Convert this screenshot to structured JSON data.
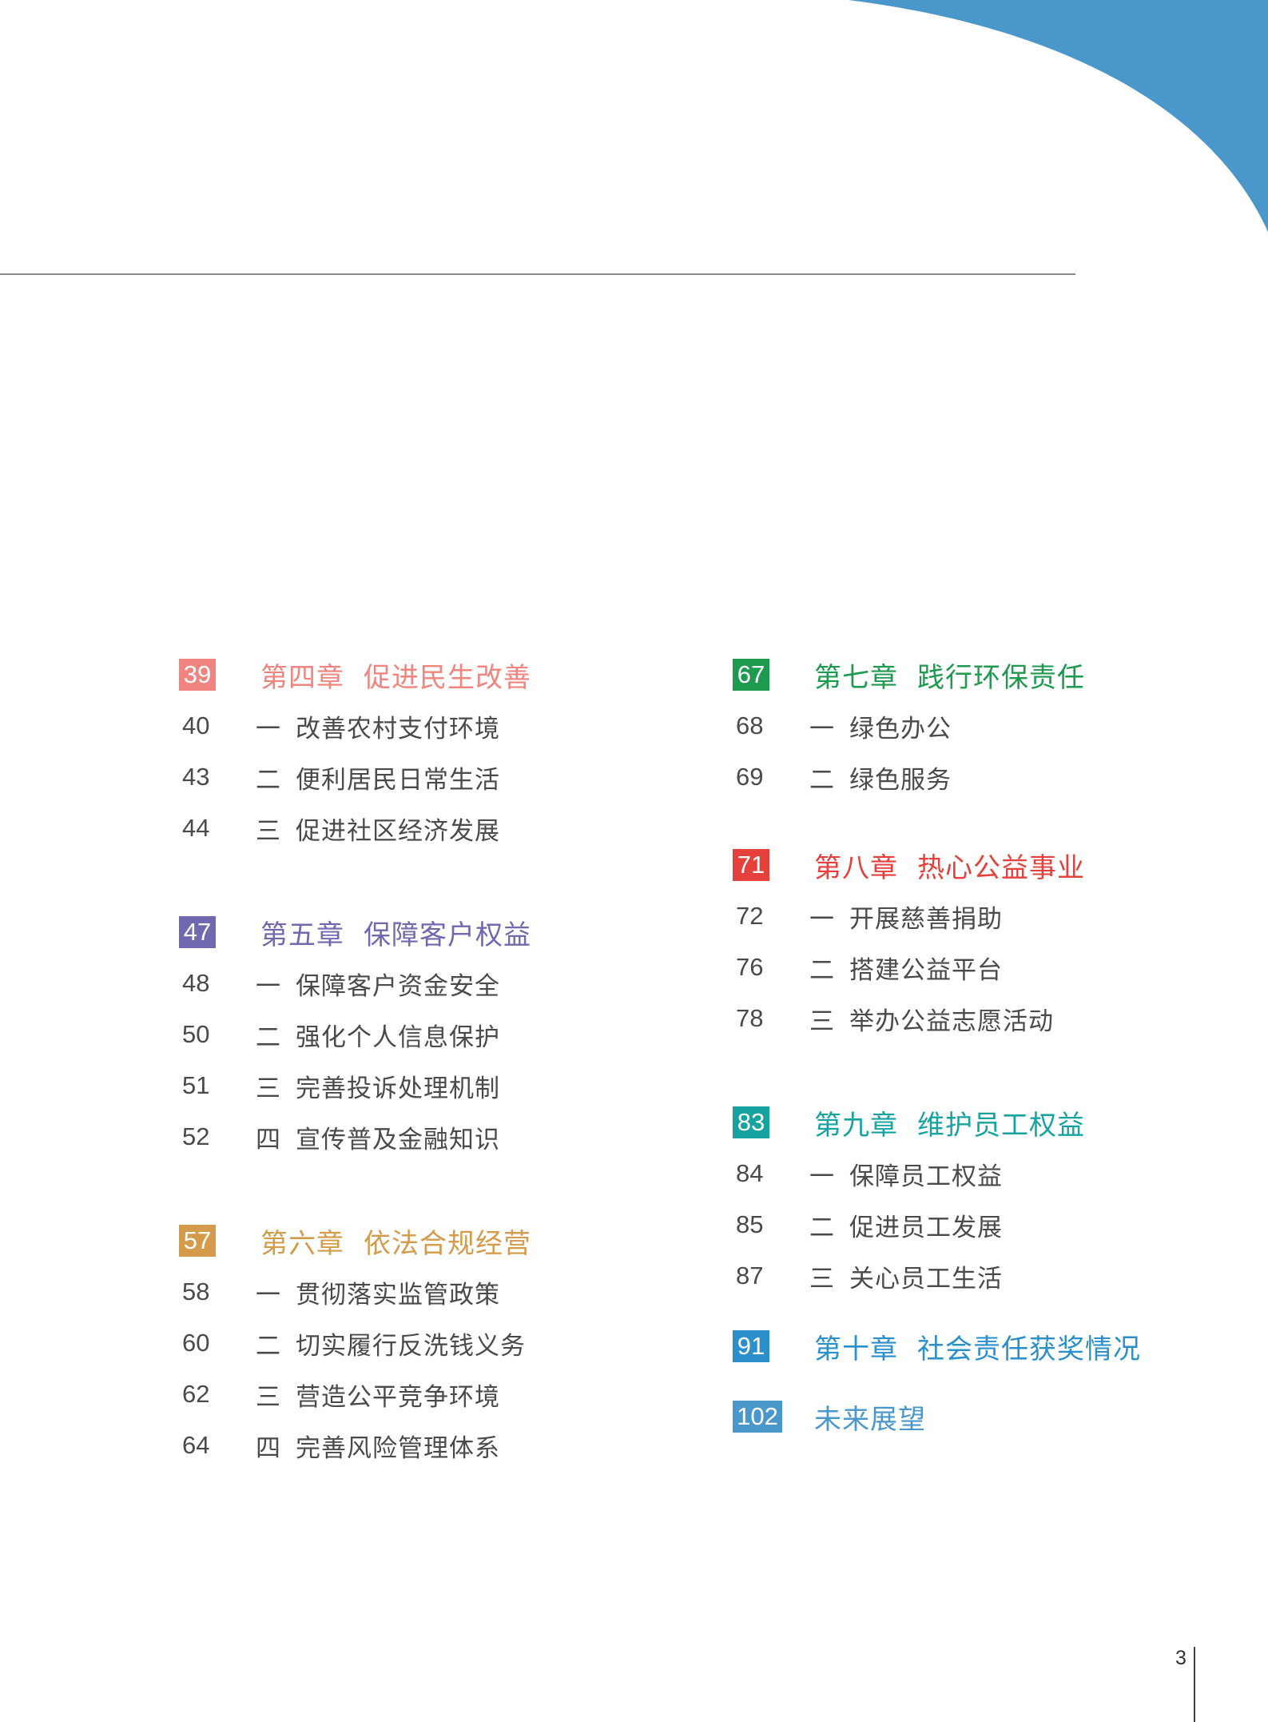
{
  "colors": {
    "corner_blue": "#4a97cc",
    "ch4": "#f0857f",
    "ch5": "#6f69b0",
    "ch6": "#d39b4a",
    "ch7": "#1e9a4f",
    "ch8": "#e5403c",
    "ch9": "#16a3a0",
    "ch10": "#2a8fcb",
    "future": "#4a97cc"
  },
  "left": {
    "ch4": {
      "page": "39",
      "no": "第四章",
      "title": "促进民生改善",
      "items": [
        {
          "page": "40",
          "num": "一",
          "text": "改善农村支付环境"
        },
        {
          "page": "43",
          "num": "二",
          "text": "便利居民日常生活"
        },
        {
          "page": "44",
          "num": "三",
          "text": "促进社区经济发展"
        }
      ]
    },
    "ch5": {
      "page": "47",
      "no": "第五章",
      "title": "保障客户权益",
      "items": [
        {
          "page": "48",
          "num": "一",
          "text": "保障客户资金安全"
        },
        {
          "page": "50",
          "num": "二",
          "text": "强化个人信息保护"
        },
        {
          "page": "51",
          "num": "三",
          "text": "完善投诉处理机制"
        },
        {
          "page": "52",
          "num": "四",
          "text": "宣传普及金融知识"
        }
      ]
    },
    "ch6": {
      "page": "57",
      "no": "第六章",
      "title": "依法合规经营",
      "items": [
        {
          "page": "58",
          "num": "一",
          "text": "贯彻落实监管政策"
        },
        {
          "page": "60",
          "num": "二",
          "text": "切实履行反洗钱义务"
        },
        {
          "page": "62",
          "num": "三",
          "text": "营造公平竞争环境"
        },
        {
          "page": "64",
          "num": "四",
          "text": "完善风险管理体系"
        }
      ]
    }
  },
  "right": {
    "ch7": {
      "page": "67",
      "no": "第七章",
      "title": "践行环保责任",
      "items": [
        {
          "page": "68",
          "num": "一",
          "text": "绿色办公"
        },
        {
          "page": "69",
          "num": "二",
          "text": "绿色服务"
        }
      ]
    },
    "ch8": {
      "page": "71",
      "no": "第八章",
      "title": "热心公益事业",
      "items": [
        {
          "page": "72",
          "num": "一",
          "text": "开展慈善捐助"
        },
        {
          "page": "76",
          "num": "二",
          "text": "搭建公益平台"
        },
        {
          "page": "78",
          "num": "三",
          "text": "举办公益志愿活动"
        }
      ]
    },
    "ch9": {
      "page": "83",
      "no": "第九章",
      "title": "维护员工权益",
      "items": [
        {
          "page": "84",
          "num": "一",
          "text": "保障员工权益"
        },
        {
          "page": "85",
          "num": "二",
          "text": "促进员工发展"
        },
        {
          "page": "87",
          "num": "三",
          "text": " 关心员工生活"
        }
      ]
    },
    "ch10": {
      "page": "91",
      "no": "第十章",
      "title": "社会责任获奖情况"
    },
    "future": {
      "page": "102",
      "title": "未来展望"
    }
  },
  "page_number": "3"
}
